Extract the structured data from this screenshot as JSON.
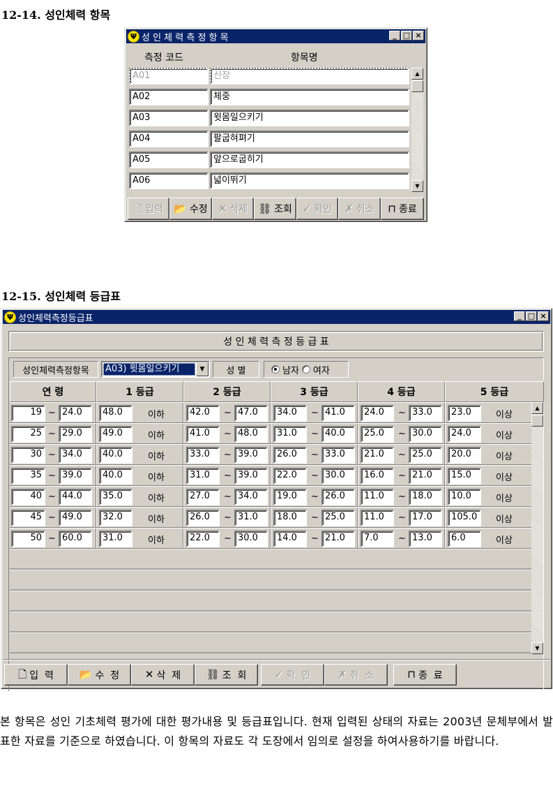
{
  "section1": {
    "title": "12-14. 성인체력 항목",
    "window": {
      "title": "성 인 체 력 측 정 항 목",
      "controls": [
        "_",
        "□",
        "×"
      ],
      "headers": {
        "code": "측정 코드",
        "name": "항목명"
      },
      "rows": [
        {
          "code": "A01",
          "name": "신장",
          "disabled": true
        },
        {
          "code": "A02",
          "name": "체중"
        },
        {
          "code": "A03",
          "name": "윗몸일으키기"
        },
        {
          "code": "A04",
          "name": "팔굽혀펴기"
        },
        {
          "code": "A05",
          "name": "앞으로굽히기"
        },
        {
          "code": "A06",
          "name": "넓이뛰기"
        }
      ],
      "toolbar": [
        {
          "label": "입력",
          "icon": "new-document-icon",
          "glyph": "🗋",
          "enabled": false
        },
        {
          "label": "수정",
          "icon": "edit-folder-icon",
          "glyph": "📂",
          "enabled": true
        },
        {
          "label": "삭제",
          "icon": "delete-x-icon",
          "glyph": "✕",
          "enabled": false
        },
        {
          "label": "조회",
          "icon": "binoculars-icon",
          "glyph": "⛓",
          "enabled": true
        },
        {
          "label": "확인",
          "icon": "checkmark-icon",
          "glyph": "✓",
          "enabled": false
        },
        {
          "label": "취소",
          "icon": "cancel-x-icon",
          "glyph": "✗",
          "enabled": false
        },
        {
          "label": "종료",
          "icon": "exit-door-icon",
          "glyph": "⊓",
          "enabled": true
        }
      ]
    }
  },
  "section2": {
    "title": "12-15. 성인체력 등급표",
    "window": {
      "title": "성인체력측정등급표",
      "controls": [
        "_",
        "□",
        "×"
      ],
      "banner": "성 인 체 력 측 정 등 급 표",
      "filter": {
        "item_label": "성인체력측정항목",
        "item_value": "A03)  윗몸일으키기",
        "gender_label": "성  별",
        "gender_options": [
          "남자",
          "여자"
        ],
        "gender_selected": "남자"
      },
      "grid": {
        "headers": [
          "연    령",
          "1  등급",
          "2  등급",
          "3  등급",
          "4  등급",
          "5  등급"
        ],
        "below_label": "이하",
        "above_label": "이상",
        "range_sep": "~",
        "rows": [
          {
            "age_from": "19",
            "age_to": "24.0",
            "g1": "48.0",
            "g2_from": "42.0",
            "g2_to": "47.0",
            "g3_from": "34.0",
            "g3_to": "41.0",
            "g4_from": "24.0",
            "g4_to": "33.0",
            "g5": "23.0"
          },
          {
            "age_from": "25",
            "age_to": "29.0",
            "g1": "49.0",
            "g2_from": "41.0",
            "g2_to": "48.0",
            "g3_from": "31.0",
            "g3_to": "40.0",
            "g4_from": "25.0",
            "g4_to": "30.0",
            "g5": "24.0"
          },
          {
            "age_from": "30",
            "age_to": "34.0",
            "g1": "40.0",
            "g2_from": "33.0",
            "g2_to": "39.0",
            "g3_from": "26.0",
            "g3_to": "33.0",
            "g4_from": "21.0",
            "g4_to": "25.0",
            "g5": "20.0"
          },
          {
            "age_from": "35",
            "age_to": "39.0",
            "g1": "40.0",
            "g2_from": "31.0",
            "g2_to": "39.0",
            "g3_from": "22.0",
            "g3_to": "30.0",
            "g4_from": "16.0",
            "g4_to": "21.0",
            "g5": "15.0"
          },
          {
            "age_from": "40",
            "age_to": "44.0",
            "g1": "35.0",
            "g2_from": "27.0",
            "g2_to": "34.0",
            "g3_from": "19.0",
            "g3_to": "26.0",
            "g4_from": "11.0",
            "g4_to": "18.0",
            "g5": "10.0"
          },
          {
            "age_from": "45",
            "age_to": "49.0",
            "g1": "32.0",
            "g2_from": "26.0",
            "g2_to": "31.0",
            "g3_from": "18.0",
            "g3_to": "25.0",
            "g4_from": "11.0",
            "g4_to": "17.0",
            "g5": "105.0"
          },
          {
            "age_from": "50",
            "age_to": "60.0",
            "g1": "31.0",
            "g2_from": "22.0",
            "g2_to": "30.0",
            "g3_from": "14.0",
            "g3_to": "21.0",
            "g4_from": "7.0",
            "g4_to": "13.0",
            "g5": "6.0"
          }
        ]
      },
      "toolbar": [
        {
          "label": "입  력",
          "icon": "new-document-icon",
          "glyph": "🗋",
          "enabled": true
        },
        {
          "label": "수  정",
          "icon": "edit-folder-icon",
          "glyph": "📂",
          "enabled": true
        },
        {
          "label": "삭  제",
          "icon": "delete-x-icon",
          "glyph": "✕",
          "enabled": true
        },
        {
          "label": "조  회",
          "icon": "binoculars-icon",
          "glyph": "⛓",
          "enabled": true
        },
        {
          "label": "확  인",
          "icon": "checkmark-icon",
          "glyph": "✓",
          "enabled": false
        },
        {
          "label": "취  소",
          "icon": "cancel-x-icon",
          "glyph": "✗",
          "enabled": false
        },
        {
          "label": "종  료",
          "icon": "exit-door-icon",
          "glyph": "⊓",
          "enabled": true
        }
      ]
    }
  },
  "description": "본 항목은 성인 기초체력 평가에 대한 평가내용 및 등급표입니다. 현재 입력된 상태의 자료는 2003년 문체부에서 발표한 자료를 기준으로 하였습니다. 이 항목의 자료도 각 도장에서 임의로 설정을 하여사용하기를 바랍니다."
}
